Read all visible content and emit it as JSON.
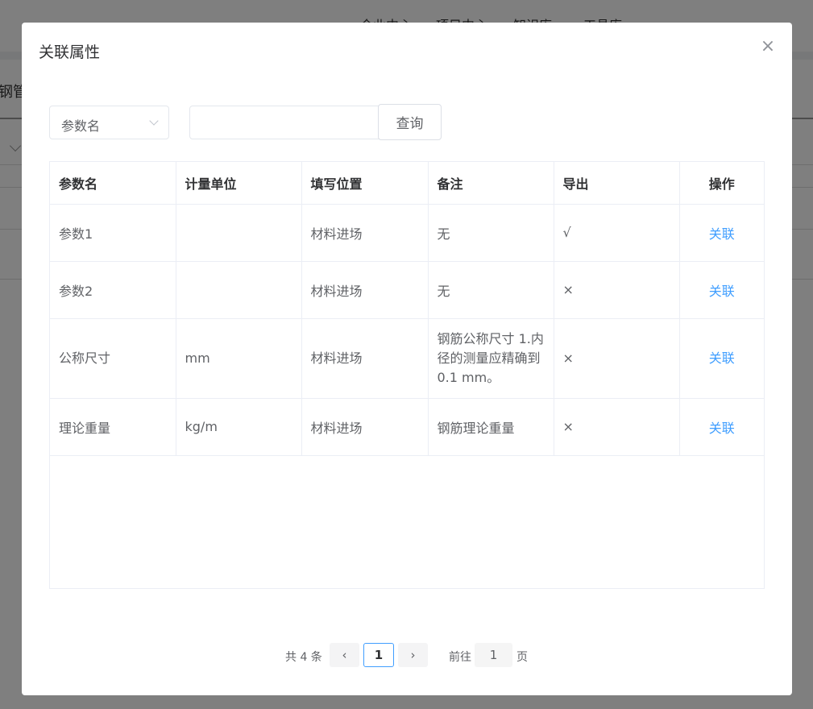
{
  "background": {
    "nav_items": [
      "企业中心",
      "项目中心",
      "知识库",
      "工具库"
    ],
    "page_title": "钢管"
  },
  "dialog": {
    "title": "关联属性",
    "close_icon": "close-icon",
    "filter": {
      "field_select_value": "参数名",
      "search_value": "",
      "search_placeholder": "",
      "query_label": "查询"
    },
    "table": {
      "columns": [
        "参数名",
        "计量单位",
        "填写位置",
        "备注",
        "导出",
        "操作"
      ],
      "rows": [
        {
          "name": "参数1",
          "unit": "",
          "position": "材料进场",
          "note": "无",
          "export": "√",
          "action": "关联"
        },
        {
          "name": "参数2",
          "unit": "",
          "position": "材料进场",
          "note": "无",
          "export": "×",
          "action": "关联"
        },
        {
          "name": "公称尺寸",
          "unit": "mm",
          "position": "材料进场",
          "note": "钢筋公称尺寸 1.内径的测量应精确到0.1 mm。",
          "export": "×",
          "action": "关联"
        },
        {
          "name": "理论重量",
          "unit": "kg/m",
          "position": "材料进场",
          "note": "钢筋理论重量",
          "export": "×",
          "action": "关联"
        }
      ]
    },
    "pagination": {
      "total_text": "共 4 条",
      "prev_icon": "‹",
      "current_page": "1",
      "next_icon": "›",
      "goto_label": "前往",
      "goto_value": "1",
      "unit_label": "页"
    }
  },
  "colors": {
    "link": "#409eff",
    "overlay": "rgba(0,0,0,0.5)",
    "active_page_border": "#409eff"
  }
}
